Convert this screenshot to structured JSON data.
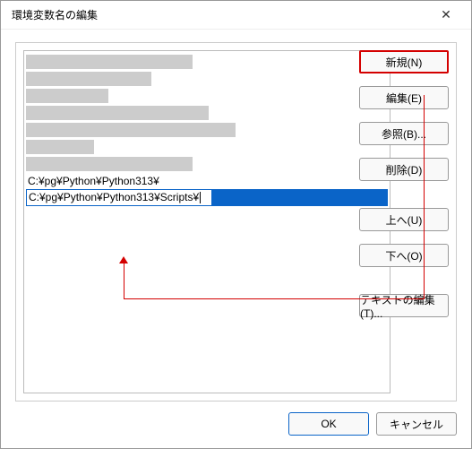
{
  "title": "環境変数名の編集",
  "close_glyph": "✕",
  "gray_widths": [
    186,
    140,
    92,
    204,
    234,
    76,
    186
  ],
  "list": {
    "plain_row": "C:¥pg¥Python¥Python313¥",
    "edit_value": "C:¥pg¥Python¥Python313¥Scripts¥",
    "edit_box_width": 208
  },
  "buttons": {
    "new": "新規(N)",
    "edit": "編集(E)",
    "browse": "参照(B)...",
    "delete": "削除(D)",
    "up": "上へ(U)",
    "down": "下へ(O)",
    "edit_text": "テキストの編集(T)..."
  },
  "footer": {
    "ok": "OK",
    "cancel": "キャンセル"
  }
}
